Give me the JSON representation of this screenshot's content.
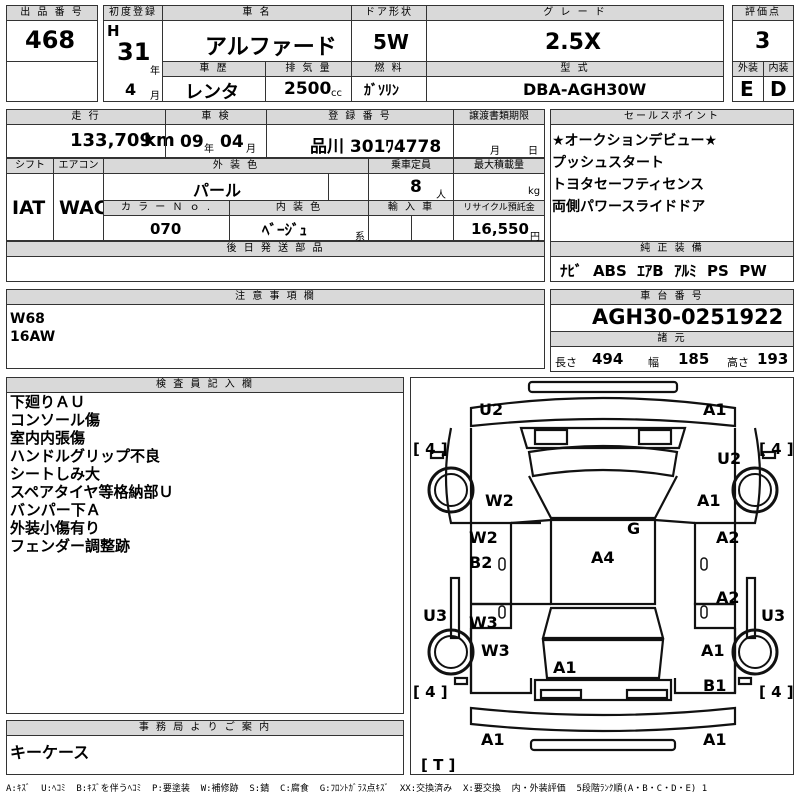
{
  "header": {
    "lot_label": "出 品 番 号",
    "lot": "468",
    "first_reg_label": "初度登録",
    "era": "H",
    "year": "31",
    "year_unit": "年",
    "month": "4",
    "month_unit": "月",
    "name_label": "車 名",
    "name": "アルファード",
    "door_label": "ドア形状",
    "door": "5W",
    "grade_label": "グ レ ー ド",
    "grade": "2.5X",
    "score_label": "評価点",
    "score": "3",
    "history_label": "車 歴",
    "history": "レンタ",
    "disp_label": "排 気 量",
    "disp": "2500",
    "disp_unit": "cc",
    "fuel_label": "燃 料",
    "fuel": "ｶﾞｿﾘﾝ",
    "model_label": "型 式",
    "model": "DBA-AGH30W",
    "ext_label": "外装",
    "ext": "E",
    "int_label": "内装",
    "int": "D"
  },
  "row2": {
    "mileage_label": "走 行",
    "mileage": "133,709",
    "mileage_unit": "km",
    "inspection_label": "車 検",
    "insp_y": "09",
    "insp_y_unit": "年",
    "insp_m": "04",
    "insp_m_unit": "月",
    "plate_label": "登 録 番 号",
    "plate": "品川 301ﾜ4778",
    "transfer_label": "譲渡書類期限",
    "transfer_m_unit": "月",
    "transfer_d_unit": "日",
    "shift_label": "シフト",
    "shift": "IAT",
    "ac_label": "エアコン",
    "ac": "WAC",
    "color_label": "外 装 色",
    "color": "パール",
    "capacity_label": "乗車定員",
    "capacity": "8",
    "capacity_unit": "人",
    "load_label": "最大積載量",
    "load_unit": "kg",
    "colorno_label": "カ ラ ー Ｎ ｏ .",
    "colorno": "070",
    "interior_label": "内 装 色",
    "interior": "ﾍﾞｰｼﾞｭ",
    "interior_unit": "系",
    "import_label": "輸 入 車",
    "recycle_label": "リサイクル預託金",
    "recycle": "16,550",
    "recycle_unit": "円",
    "later_label": "後 日 発 送 部 品"
  },
  "sales": {
    "label": "セールスポイント",
    "lines": [
      "★オークションデビュー★",
      "プッシュスタート",
      "トヨタセーフティセンス",
      "両側パワースライドドア"
    ]
  },
  "equipment": {
    "label": "純 正 装 備",
    "value": "ﾅﾋﾞ  ABS  ｴｱB  ｱﾙﾐ  PS  PW"
  },
  "notes": {
    "label": "注 意 事 項 欄",
    "lines": [
      "W68",
      "16AW"
    ]
  },
  "chassis": {
    "label": "車 台 番 号",
    "value": "AGH30-0251922"
  },
  "specs": {
    "label": "諸 元",
    "len_label": "長さ",
    "len": "494",
    "wid_label": "幅",
    "wid": "185",
    "hgt_label": "高さ",
    "hgt": "193"
  },
  "inspector": {
    "label": "検 査 員 記 入 欄",
    "lines": [
      "下廻りＡＵ",
      "コンソール傷",
      "室内内張傷",
      "ハンドルグリップ不良",
      "シートしみ大",
      "スペアタイヤ等格納部Ｕ",
      "バンパー下Ａ",
      "外装小傷有り",
      "フェンダー調整跡"
    ]
  },
  "office": {
    "label": "事 務 局 よ り ご 案 内",
    "value": "キーケース"
  },
  "diagram": {
    "marks": [
      {
        "t": "U2"
      },
      {
        "t": "A1"
      },
      {
        "t": "U2"
      },
      {
        "t": "W2"
      },
      {
        "t": "A1"
      },
      {
        "t": "G"
      },
      {
        "t": "W2"
      },
      {
        "t": "A2"
      },
      {
        "t": "B2"
      },
      {
        "t": "A4"
      },
      {
        "t": "A2"
      },
      {
        "t": "U3"
      },
      {
        "t": "W3"
      },
      {
        "t": "U3"
      },
      {
        "t": "W3"
      },
      {
        "t": "A1"
      },
      {
        "t": "A1"
      },
      {
        "t": "B1"
      },
      {
        "t": "A1"
      },
      {
        "t": "A1"
      }
    ],
    "tires": [
      "4",
      "4",
      "4",
      "4",
      "T"
    ]
  },
  "legend": "A:ｷｽﾞ  U:ﾍｺﾐ  B:ｷｽﾞを伴うﾍｺﾐ  P:要塗装  W:補修跡  S:錆  C:腐食  G:ﾌﾛﾝﾄｶﾞﾗｽ点ｷｽﾞ  XX:交換済み  X:要交換  内・外装評価  5段階ﾗﾝｸ順(A・B・C・D・E) 1"
}
